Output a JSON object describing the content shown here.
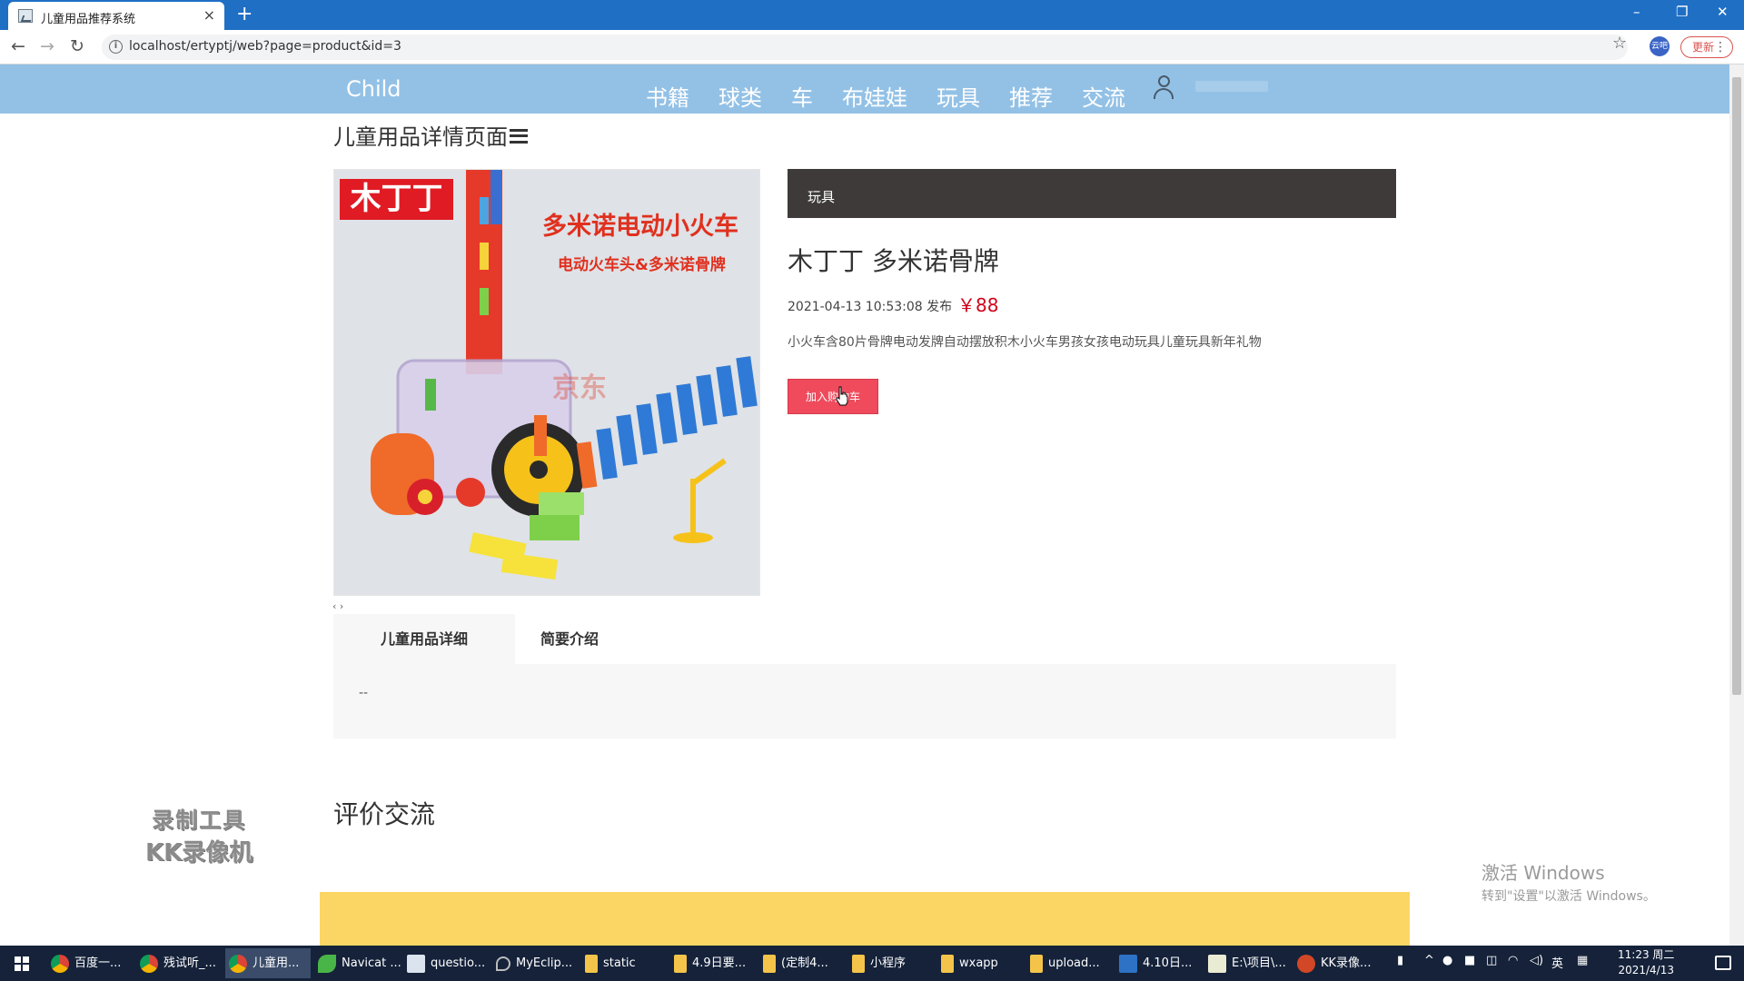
{
  "browser": {
    "tab_title": "儿童用品推荐系统",
    "tab_close": "×",
    "new_tab": "+",
    "url": "localhost/ertyptj/web?page=product&id=3",
    "update_label": "更新",
    "ext_label": "云吧",
    "window_controls": [
      "–",
      "❐",
      "✕"
    ]
  },
  "site": {
    "brand": "Child",
    "nav": [
      "书籍",
      "球类",
      "车",
      "布娃娃",
      "玩具",
      "推荐",
      "交流"
    ]
  },
  "page": {
    "title": "儿童用品详情页面"
  },
  "product": {
    "image_texts": {
      "brand": "木丁丁",
      "headline": "多米诺电动小火车",
      "subline": "电动火车头&多米诺骨牌",
      "watermark": "京东"
    },
    "category": "玩具",
    "name": "木丁丁 多米诺骨牌",
    "date": "2021-04-13 10:53:08 发布",
    "price": "￥88",
    "description": "小火车含80片骨牌电动发牌自动摆放积木小火车男孩女孩电动玩具儿童玩具新年礼物",
    "cart_button": "加入购物车",
    "image_arrows": "‹ ›"
  },
  "tabs": {
    "items": [
      "儿童用品详细",
      "简要介绍"
    ],
    "content": "--"
  },
  "reviews": {
    "title": "评价交流"
  },
  "overlay": {
    "recorder_line1": "录制工具",
    "recorder_line2": "KK录像机",
    "activate_line1": "激活 Windows",
    "activate_line2": "转到\"设置\"以激活 Windows。"
  },
  "taskbar": {
    "items": [
      {
        "label": "百度一...",
        "icon": "chrome"
      },
      {
        "label": "残试听_...",
        "icon": "chrome"
      },
      {
        "label": "儿童用...",
        "icon": "chrome"
      },
      {
        "label": "Navicat ...",
        "icon": "leaf"
      },
      {
        "label": "questio...",
        "icon": "win"
      },
      {
        "label": "MyEclip...",
        "icon": "ecl"
      },
      {
        "label": "static",
        "icon": "folder"
      },
      {
        "label": "4.9日要...",
        "icon": "folder"
      },
      {
        "label": "(定制4...",
        "icon": "folder"
      },
      {
        "label": "小程序",
        "icon": "folder"
      },
      {
        "label": "wxapp",
        "icon": "folder"
      },
      {
        "label": "upload...",
        "icon": "folder"
      },
      {
        "label": "4.10日...",
        "icon": "vs"
      },
      {
        "label": "E:\\项目\\...",
        "icon": "doc"
      },
      {
        "label": "KK录像...",
        "icon": "kk"
      }
    ],
    "ime": "英",
    "time": "11:23 周二",
    "date": "2021/4/13",
    "accent": "#1f6fc5"
  }
}
